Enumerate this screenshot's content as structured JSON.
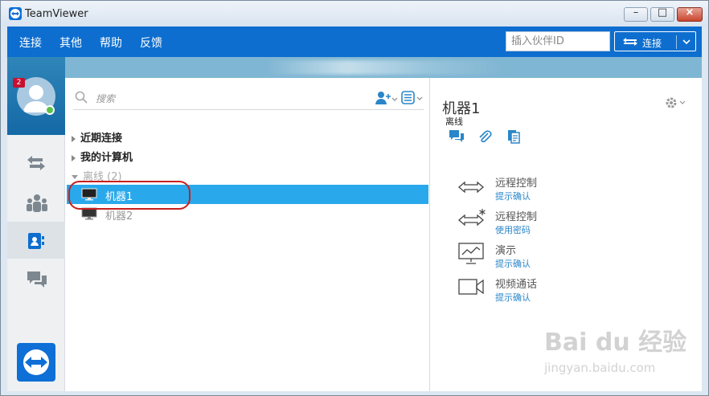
{
  "window": {
    "title": "TeamViewer"
  },
  "menu": {
    "items": [
      "连接",
      "其他",
      "帮助",
      "反馈"
    ]
  },
  "partner": {
    "placeholder": "插入伙伴ID",
    "connect_label": "连接"
  },
  "sidebar": {
    "badge": "2"
  },
  "search": {
    "placeholder": "搜索"
  },
  "groups": {
    "recent": "近期连接",
    "my_computers": "我的计算机",
    "offline": "离线 (2)"
  },
  "computers": [
    {
      "name": "机器1",
      "selected": true
    },
    {
      "name": "机器2",
      "selected": false
    }
  ],
  "detail": {
    "name": "机器1",
    "status": "离线",
    "actions": [
      {
        "title": "远程控制",
        "sub": "提示确认",
        "icon": "remote-control-icon"
      },
      {
        "title": "远程控制",
        "sub": "使用密码",
        "icon": "remote-control-password-icon"
      },
      {
        "title": "演示",
        "sub": "提示确认",
        "icon": "presentation-icon"
      },
      {
        "title": "视频通话",
        "sub": "提示确认",
        "icon": "video-call-icon"
      }
    ]
  },
  "watermark": {
    "line1": "Bai du 经验",
    "line2": "jingyan.baidu.com"
  },
  "colors": {
    "accent": "#0d6ecf",
    "selected": "#29a9ec",
    "link": "#2a86c8",
    "annotation": "#c8201e"
  }
}
